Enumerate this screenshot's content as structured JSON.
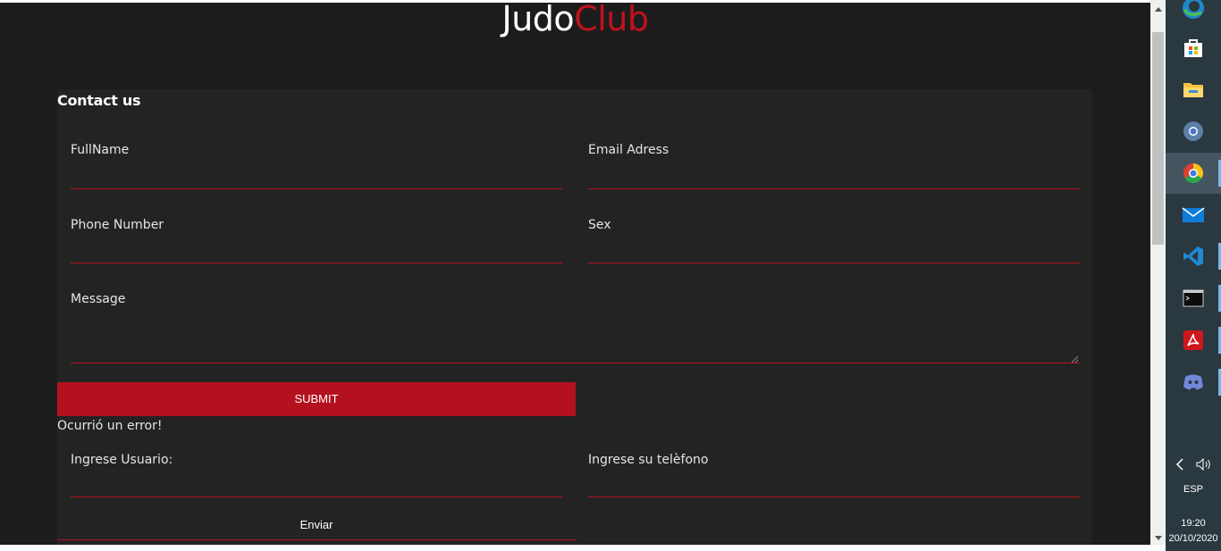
{
  "logo": {
    "part1": "Judo",
    "part2": "Club"
  },
  "contact": {
    "title": "Contact us",
    "fields": {
      "fullname": "FullName",
      "email": "Email Adress",
      "phone": "Phone Number",
      "sex": "Sex",
      "message": "Message"
    },
    "submit_label": "SUBMIT",
    "error": "Ocurrió un error!"
  },
  "login": {
    "user_label": "Ingrese Usuario:",
    "phone_label": "Ingrese su telèfono",
    "send_label": "Enviar"
  },
  "colors": {
    "accent": "#b3111e",
    "page_bg": "#1c1c1c",
    "card_bg": "#232323"
  },
  "taskbar": {
    "apps": [
      "edge-icon",
      "store-icon",
      "file-explorer-icon",
      "chrome-canary-icon",
      "chrome-icon",
      "mail-icon",
      "vscode-icon",
      "terminal-icon",
      "acrobat-icon",
      "discord-icon"
    ],
    "language": "ESP",
    "time": "19:20",
    "date": "20/10/2020"
  }
}
